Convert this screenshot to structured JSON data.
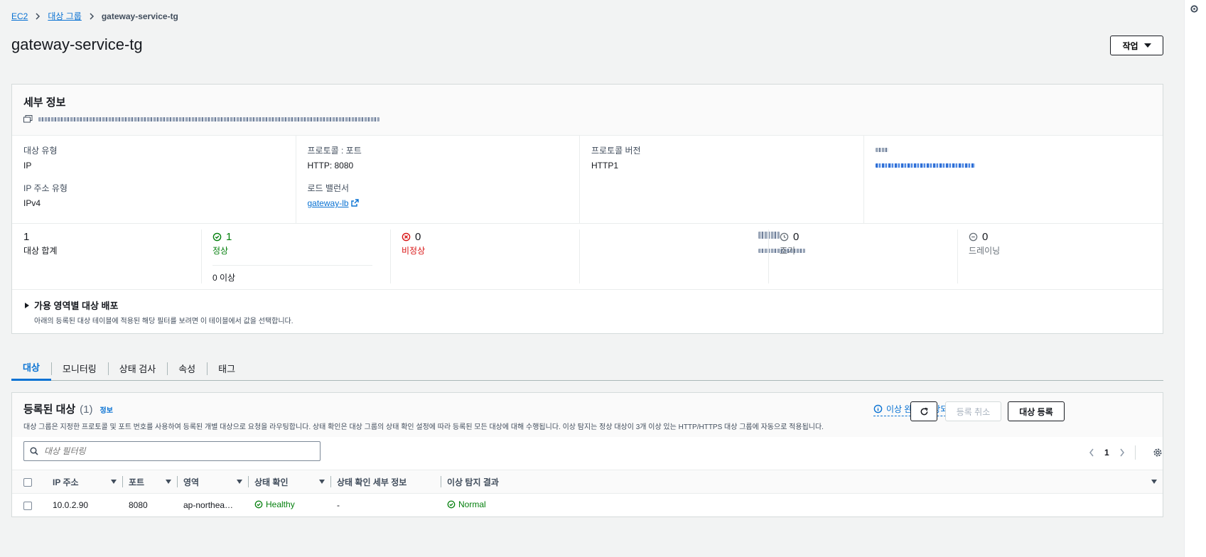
{
  "breadcrumb": {
    "root": "EC2",
    "parent": "대상 그룹",
    "current": "gateway-service-tg"
  },
  "page_title": "gateway-service-tg",
  "actions_label": "작업",
  "details": {
    "title": "세부 정보",
    "fields": {
      "target_type_label": "대상 유형",
      "target_type_value": "IP",
      "ip_type_label": "IP 주소 유형",
      "ip_type_value": "IPv4",
      "protocol_port_label": "프로토콜 : 포트",
      "protocol_port_value": "HTTP: 8080",
      "lb_label": "로드 밸런서",
      "lb_value": "gateway-lb",
      "protocol_version_label": "프로토콜 버전",
      "protocol_version_value": "HTTP1"
    },
    "stats": {
      "total_num": "1",
      "total_label": "대상 합계",
      "healthy_num": "1",
      "healthy_label": "정상",
      "healthy_sub": "0 이상",
      "unhealthy_num": "0",
      "unhealthy_label": "비정상",
      "initial_num": "0",
      "initial_label": "조기",
      "draining_num": "0",
      "draining_label": "드레이닝"
    },
    "az_title": "가용 영역별 대상 배포",
    "az_desc": "아래의 등록된 대상 테이블에 적용된 해당 필터를 보려면 이 테이블에서 값을 선택합니다."
  },
  "tabs": [
    "대상",
    "모니터링",
    "상태 검사",
    "속성",
    "태그"
  ],
  "targets": {
    "title": "등록된 대상",
    "count": "(1)",
    "info": "정보",
    "description": "대상 그룹은 지정한 프로토콜 및 포트 번호를 사용하여 등록된 개별 대상으로 요청을 라우팅합니다. 상태 확인은 대상 그룹의 상태 확인 설정에 따라 등록된 모든 대상에 대해 수행됩니다. 이상 탐지는 정상 대상이 3개 이상 있는 HTTP/HTTPS 대상 그룹에 자동으로 적용됩니다.",
    "anomaly_link": "이상 완화: 해당되지 않음",
    "deregister_label": "등록 취소",
    "register_label": "대상 등록",
    "filter_placeholder": "대상 필터링",
    "page": "1",
    "columns": [
      "IP 주소",
      "포트",
      "영역",
      "상태 확인",
      "상태 확인 세부 정보",
      "이상 탐지 결과"
    ],
    "rows": [
      {
        "ip": "10.0.2.90",
        "port": "8080",
        "zone": "ap-northea…",
        "health": "Healthy",
        "details": "-",
        "anomaly": "Normal"
      }
    ]
  }
}
